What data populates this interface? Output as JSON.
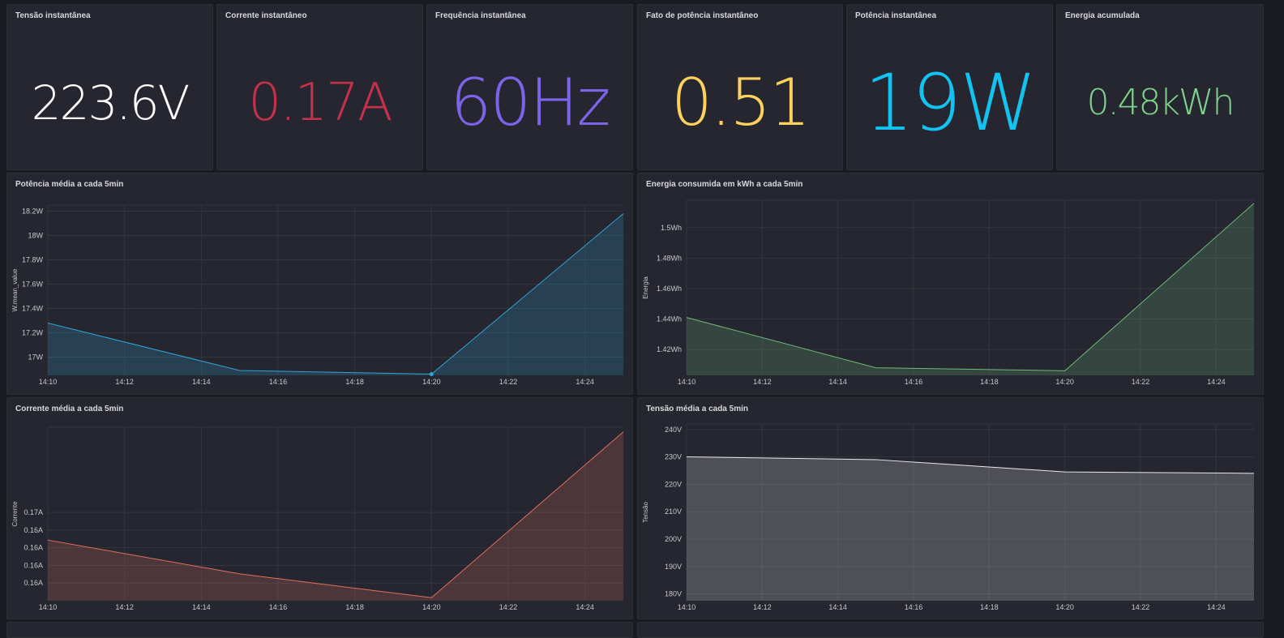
{
  "stats": [
    {
      "title": "Tensão instantânea",
      "value": "223.6V",
      "color": "#ffffff",
      "size": 58
    },
    {
      "title": "Corrente instantâneo",
      "value": "0.17A",
      "color": "#c4314b",
      "size": 64
    },
    {
      "title": "Frequência instantânea",
      "value": "60Hz",
      "color": "#7d63ea",
      "size": 80
    },
    {
      "title": "Fato de potência instantâneo",
      "value": "0.51",
      "color": "#fbd25d",
      "size": 80
    },
    {
      "title": "Potência instantânea",
      "value": "19W",
      "color": "#12c3f2",
      "size": 96
    },
    {
      "title": "Energia acumulada",
      "value": "0.48kWh",
      "color": "#80d38c",
      "size": 44
    }
  ],
  "chart_data": [
    {
      "type": "area",
      "title": "Potência média a cada 5min",
      "ylabel": "W.mean_value",
      "color": "#33a2d6",
      "x": [
        "14:10",
        "14:15",
        "14:20",
        "14:25"
      ],
      "values": [
        17.28,
        16.89,
        16.86,
        18.18
      ],
      "ylim": [
        16.85,
        18.25
      ],
      "yticks": [
        {
          "v": 17.0,
          "label": "17W"
        },
        {
          "v": 17.2,
          "label": "17.2W"
        },
        {
          "v": 17.4,
          "label": "17.4W"
        },
        {
          "v": 17.6,
          "label": "17.6W"
        },
        {
          "v": 17.8,
          "label": "17.8W"
        },
        {
          "v": 18.0,
          "label": "18W"
        },
        {
          "v": 18.2,
          "label": "18.2W"
        }
      ],
      "xticks": [
        "14:10",
        "14:12",
        "14:14",
        "14:16",
        "14:18",
        "14:20",
        "14:22",
        "14:24"
      ],
      "highlight_point": 2
    },
    {
      "type": "area",
      "title": "Energia consumida em kWh a cada 5min",
      "ylabel": "Energia",
      "color": "#70b87a",
      "x": [
        "14:10",
        "14:15",
        "14:20",
        "14:25"
      ],
      "values": [
        1.441,
        1.408,
        1.406,
        1.516
      ],
      "ylim": [
        1.403,
        1.518
      ],
      "yticks": [
        {
          "v": 1.42,
          "label": "1.42Wh"
        },
        {
          "v": 1.44,
          "label": "1.44Wh"
        },
        {
          "v": 1.46,
          "label": "1.46Wh"
        },
        {
          "v": 1.48,
          "label": "1.48Wh"
        },
        {
          "v": 1.5,
          "label": "1.5Wh"
        }
      ],
      "xticks": [
        "14:10",
        "14:12",
        "14:14",
        "14:16",
        "14:18",
        "14:20",
        "14:22",
        "14:24"
      ]
    },
    {
      "type": "area",
      "title": "Corrente média a cada 5min",
      "ylabel": "Corrente",
      "color": "#e07060",
      "x": [
        "14:10",
        "14:15",
        "14:20",
        "14:25"
      ],
      "values": [
        0.1626,
        0.1582,
        0.1551,
        0.1767
      ],
      "ylim": [
        0.1547,
        0.1773
      ],
      "yticks": [
        {
          "v": 0.157,
          "label": "0.16A"
        },
        {
          "v": 0.1593,
          "label": "0.16A"
        },
        {
          "v": 0.1616,
          "label": "0.16A"
        },
        {
          "v": 0.1639,
          "label": "0.16A"
        },
        {
          "v": 0.1662,
          "label": "0.17A"
        }
      ],
      "xticks": [
        "14:10",
        "14:12",
        "14:14",
        "14:16",
        "14:18",
        "14:20",
        "14:22",
        "14:24"
      ],
      "ytick_order_note": ""
    },
    {
      "type": "area",
      "title": "Tensão média a cada 5min",
      "ylabel": "Tensão",
      "color": "#e8e8ea",
      "x": [
        "14:10",
        "14:15",
        "14:20",
        "14:25"
      ],
      "values": [
        230.0,
        229.0,
        224.5,
        224.0
      ],
      "ylim": [
        177.5,
        242.0
      ],
      "yticks": [
        {
          "v": 180,
          "label": "180V"
        },
        {
          "v": 190,
          "label": "190V"
        },
        {
          "v": 200,
          "label": "200V"
        },
        {
          "v": 210,
          "label": "210V"
        },
        {
          "v": 220,
          "label": "220V"
        },
        {
          "v": 230,
          "label": "230V"
        },
        {
          "v": 240,
          "label": "240V"
        }
      ],
      "xticks": [
        "14:10",
        "14:12",
        "14:14",
        "14:16",
        "14:18",
        "14:20",
        "14:22",
        "14:24"
      ]
    }
  ]
}
